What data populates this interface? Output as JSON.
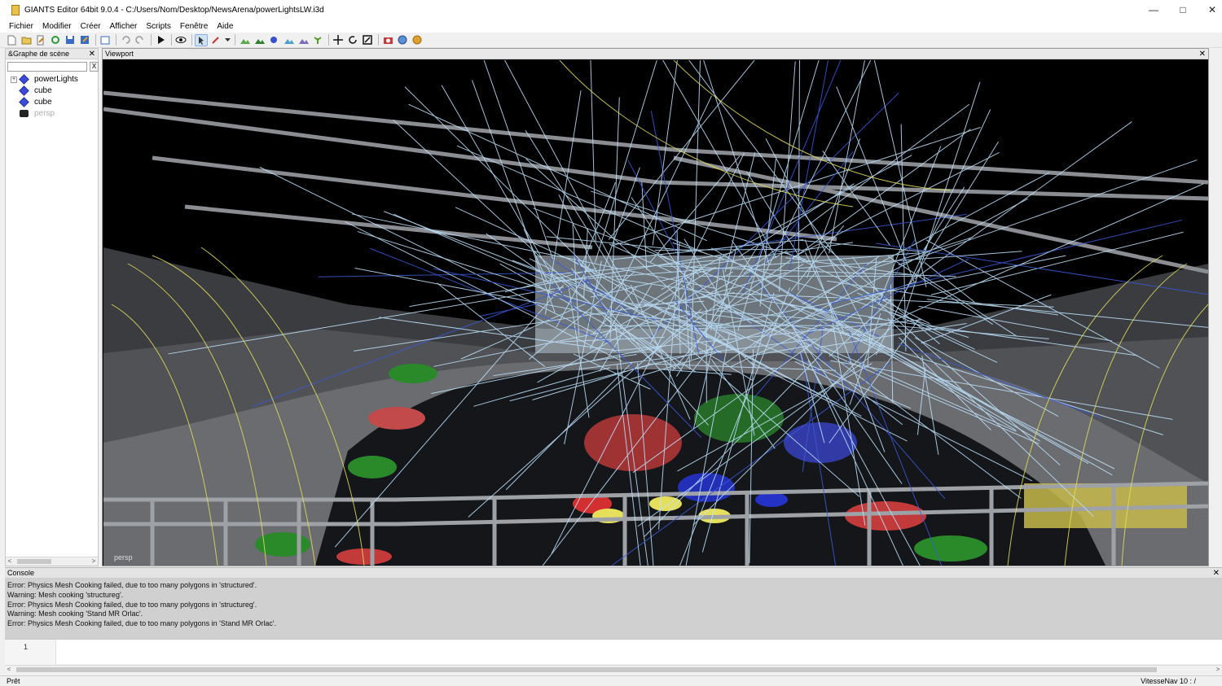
{
  "window": {
    "title": "GIANTS Editor 64bit 9.0.4 - C:/Users/Nom/Desktop/NewsArena/powerLightsLW.i3d",
    "minimize": "—",
    "maximize": "□",
    "close": "✕"
  },
  "menu": [
    "Fichier",
    "Modifier",
    "Créer",
    "Afficher",
    "Scripts",
    "Fenêtre",
    "Aide"
  ],
  "toolbar": {
    "icons": [
      "new-file-icon",
      "open-folder-icon",
      "edit-file-icon",
      "refresh-icon",
      "save-icon",
      "save-as-icon",
      "import-icon",
      "undo-icon",
      "redo-icon",
      "play-icon",
      "eye-icon",
      "select-tool-icon",
      "paint-tool-icon",
      "dropdown-arrow-icon",
      "terrain-icon",
      "terrain-paint-icon",
      "object-paint-icon",
      "foliage-icon",
      "decal-icon",
      "plant-icon",
      "move-icon",
      "rotate-icon",
      "scale-icon",
      "camera-icon",
      "globe-icon",
      "help-icon"
    ]
  },
  "scenegraph": {
    "title": "&Graphe de scène",
    "close": "✕",
    "search_value": "",
    "clear_label": "X",
    "items": [
      {
        "label": "powerLights",
        "icon": "cube-icon",
        "expander": "+"
      },
      {
        "label": "cube",
        "icon": "cube-icon"
      },
      {
        "label": "cube",
        "icon": "cube-icon"
      },
      {
        "label": "persp",
        "icon": "camera-icon"
      }
    ]
  },
  "viewport": {
    "title": "Viewport",
    "close": "✕",
    "camera_label": "persp"
  },
  "console": {
    "title": "Console",
    "close": "✕",
    "lines": [
      "Error: Physics Mesh Cooking failed, due to too many polygons in 'structured'.",
      "Warning: Mesh cooking 'structureg'.",
      "Error: Physics Mesh Cooking failed, due to too many polygons in 'structureg'.",
      "Warning: Mesh cooking 'Stand MR Orlac'.",
      "Error: Physics Mesh Cooking failed, due to too many polygons in 'Stand MR Orlac'."
    ]
  },
  "script_editor": {
    "line_number": "1"
  },
  "status": {
    "left": "Prêt",
    "right": "VitesseNav 10 : /"
  },
  "colors": {
    "light_beam": "#bfe4ff",
    "selection_blue": "#3a4bd6",
    "gizmo_yellow": "#e5df5c"
  }
}
